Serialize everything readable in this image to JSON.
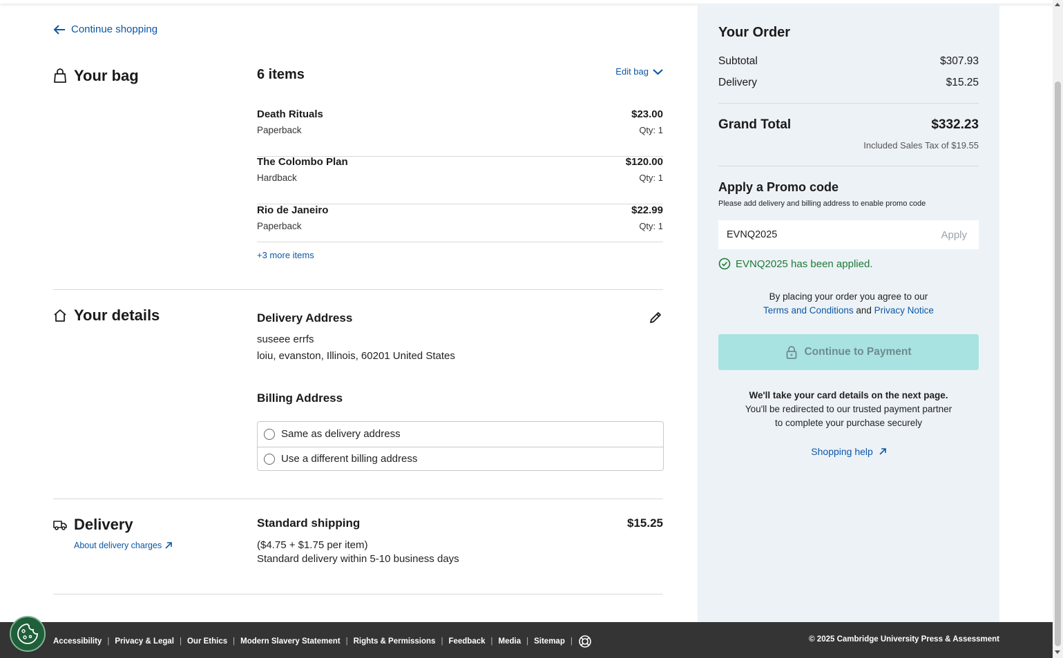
{
  "nav": {
    "continue_shopping": "Continue shopping"
  },
  "bag": {
    "title": "Your bag",
    "count": "6 items",
    "edit_label": "Edit bag",
    "items": [
      {
        "name": "Death Rituals",
        "format": "Paperback",
        "price": "$23.00",
        "qty": "Qty: 1"
      },
      {
        "name": "The Colombo Plan",
        "format": "Hardback",
        "price": "$120.00",
        "qty": "Qty: 1"
      },
      {
        "name": "Rio de Janeiro",
        "format": "Paperback",
        "price": "$22.99",
        "qty": "Qty: 1"
      }
    ],
    "more_items": "+3 more items"
  },
  "details": {
    "title": "Your details",
    "delivery_address_title": "Delivery Address",
    "name": "suseee errfs",
    "address": "loiu, evanston, Illinois, 60201 United States",
    "billing_title": "Billing Address",
    "billing_options": [
      "Same as delivery address",
      "Use a different billing address"
    ]
  },
  "delivery": {
    "title": "Delivery",
    "about_link": "About delivery charges",
    "method": "Standard shipping",
    "price": "$15.25",
    "formula": "($4.75 + $1.75 per item)",
    "timeframe": "Standard delivery within 5-10 business days"
  },
  "order": {
    "title": "Your Order",
    "subtotal_label": "Subtotal",
    "subtotal_value": "$307.93",
    "delivery_label": "Delivery",
    "delivery_value": "$15.25",
    "grand_total_label": "Grand Total",
    "grand_total_value": "$332.23",
    "tax_note": "Included Sales Tax of $19.55",
    "promo_title": "Apply a Promo code",
    "promo_note": "Please add delivery and billing address to enable promo code",
    "promo_value": "EVNQ2025",
    "promo_apply": "Apply",
    "promo_applied": "EVNQ2025 has been applied.",
    "agree_text": "By placing your order you agree to our",
    "terms_link": "Terms and Conditions",
    "and_text": "and",
    "privacy_link": "Privacy Notice",
    "pay_button": "Continue to Payment",
    "card_note_bold": "We'll take your card details on the next page.",
    "card_note_1": "You'll be redirected to our trusted payment partner",
    "card_note_2": "to complete your purchase securely",
    "help_link": "Shopping help"
  },
  "footer": {
    "links": [
      "Accessibility",
      "Privacy & Legal",
      "Our Ethics",
      "Modern Slavery Statement",
      "Rights & Permissions",
      "Feedback",
      "Media",
      "Sitemap"
    ],
    "copyright": "© 2025 Cambridge University Press & Assessment"
  },
  "colors": {
    "accent": "#0b57a4",
    "success": "#1d7a35",
    "pay_button": "#a8e3e1",
    "sidebar_bg": "#edf2f7",
    "footer_bg": "#343434"
  }
}
